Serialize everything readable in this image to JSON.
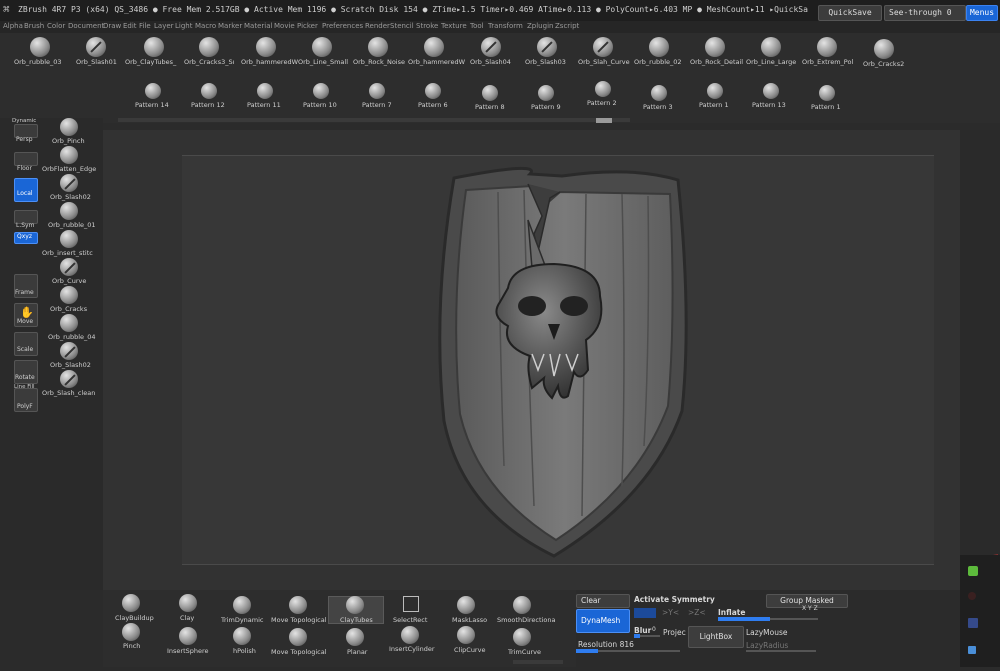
{
  "titlebar": {
    "title": "ZBrush 4R7 P3 (x64)   QS_3486   ● Free Mem 2.517GB ● Active Mem 1196 ● Scratch Disk 154 ●  ZTime▸1.5 Timer▸0.469 ATime▸0.113 ● PolyCount▸6.403 MP  ● MeshCount▸11  ▸QuickSa",
    "quicksave": "QuickSave",
    "seethrough": "See-through  0",
    "menus": "Menus"
  },
  "menubar": [
    "Alpha",
    "Brush",
    "Color",
    "Document",
    "Draw",
    "Edit",
    "File",
    "Layer",
    "Light",
    "Macro",
    "Marker",
    "Material",
    "Movie",
    "Picker",
    "Preferences",
    "Render",
    "Stencil",
    "Stroke",
    "Texture",
    "Tool",
    "Transform",
    "Zplugin",
    "Zscript"
  ],
  "top_brushes": [
    "Orb_rubble_03",
    "Orb_Slash01",
    "Orb_ClayTubes_",
    "Orb_Cracks3_Sı",
    "Orb_hammeredW",
    "Orb_Line_Small",
    "Orb_Rock_Noise",
    "Orb_hammeredW",
    "Orb_Slash04",
    "Orb_Slash03",
    "Orb_Slah_Curve",
    "Orb_rubble_02",
    "Orb_Rock_Detail",
    "Orb_Line_Large",
    "Orb_Extrem_Pol",
    "Orb_Cracks2"
  ],
  "patterns": [
    "Pattern 14",
    "Pattern 12",
    "Pattern 11",
    "Pattern 10",
    "Pattern 7",
    "Pattern 6",
    "Pattern 8",
    "Pattern 9",
    "Pattern 2",
    "Pattern 3",
    "Pattern 1",
    "Pattern 13",
    "Pattern 1"
  ],
  "left_tools": [
    "Dynamic",
    "Persp",
    "Floor",
    "Local",
    "L.Sym",
    "Qxyz",
    "Frame",
    "Move",
    "Scale",
    "Rotate",
    "Line Fill",
    "PolyF"
  ],
  "left_brushes": [
    "Orb_Pinch",
    "OrbFlatten_Edge",
    "Orb_Slash02",
    "Orb_rubble_01",
    "Orb_insert_stitc",
    "Orb_Curve",
    "Orb_Cracks",
    "Orb_rubble_04",
    "Orb_Slash02",
    "Orb_Slash_clean"
  ],
  "bottom_brushes_row1": [
    "ClayBuildup",
    "Clay",
    "TrimDynamic",
    "Move Topological",
    "ClayTubes",
    "SelectRect",
    "MaskLasso",
    "SmoothDirectiona"
  ],
  "bottom_brushes_row2": [
    "Pinch",
    "InsertSphere",
    "hPolish",
    "Move Topological",
    "Planar",
    "InsertCylinder",
    "ClipCurve",
    "TrimCurve"
  ],
  "dynamesh": {
    "clear": "Clear",
    "activate_symmetry": "Activate Symmetry",
    "group_masked": "Group Masked",
    "dynamesh": "DynaMesh",
    "sym_y": ">Y<",
    "sym_z": ">Z<",
    "inflate": "Inflate",
    "xyz": "X Y Z",
    "blur": "Blur",
    "blur_value": "0",
    "project": "Projec",
    "lightbox": "LightBox",
    "lazymouse": "LazyMouse",
    "lazyradius": "LazyRadius",
    "resolution": "Resolution 816"
  },
  "colors": {
    "accent": "#1a66d6",
    "bg": "#2b2b2b",
    "viewport": "#323232",
    "shield_edge": "#6a6a6a"
  }
}
